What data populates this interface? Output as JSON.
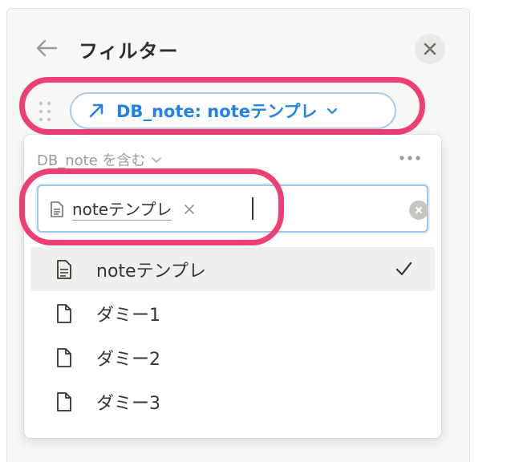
{
  "header": {
    "title": "フィルター",
    "back_icon": "arrow-left-icon",
    "close_icon": "close-icon"
  },
  "filter_pill": {
    "label": "DB_note: noteテンプレ",
    "icon": "relation-arrow-icon",
    "chevron_icon": "chevron-down-icon",
    "accent_color": "#2383e2"
  },
  "dropdown": {
    "condition_label": "DB_note を含む",
    "more_icon": "more-horizontal-icon",
    "selected_tag": {
      "label": "noteテンプレ",
      "icon": "document-icon"
    },
    "options": [
      {
        "label": "noteテンプレ",
        "icon": "document-lines-icon",
        "selected": true
      },
      {
        "label": "ダミー1",
        "icon": "page-icon",
        "selected": false
      },
      {
        "label": "ダミー2",
        "icon": "page-icon",
        "selected": false
      },
      {
        "label": "ダミー3",
        "icon": "page-icon",
        "selected": false
      }
    ]
  },
  "annotations": {
    "highlight_color": "#ee3f74"
  }
}
